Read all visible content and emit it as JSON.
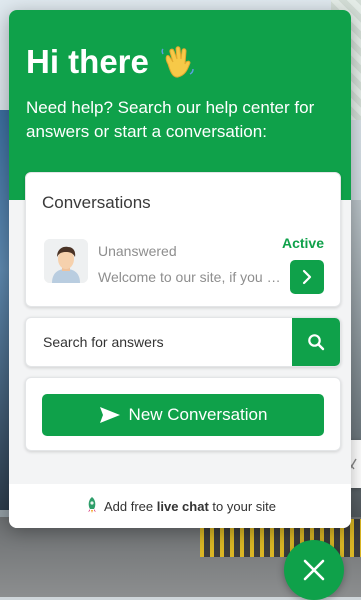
{
  "header": {
    "greeting": "Hi there",
    "subtitle": "Need help? Search our help center for answers or start a conversation:"
  },
  "conversations": {
    "title": "Conversations",
    "item": {
      "status": "Unanswered",
      "preview": "Welcome to our site, if you need help simply reply to this message",
      "state": "Active"
    }
  },
  "search": {
    "placeholder": "Search for answers"
  },
  "new_conversation": {
    "label": "New Conversation"
  },
  "footer": {
    "prefix": "Add free",
    "link": "live chat",
    "suffix": "to your site"
  },
  "colors": {
    "brand": "#0fa14a",
    "panel": "#f3f4f5",
    "text_muted": "#8e8e8e"
  },
  "icons": [
    "waving-hand-icon",
    "chevron-right-icon",
    "search-icon",
    "send-icon",
    "rocket-icon",
    "close-icon",
    "avatar-icon"
  ]
}
